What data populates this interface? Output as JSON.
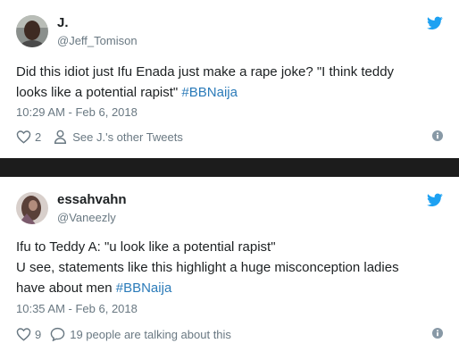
{
  "colors": {
    "link": "#2b7bb9",
    "muted": "#697882",
    "twitter_blue": "#1da1f2"
  },
  "tweets": [
    {
      "name": "J.",
      "handle": "@Jeff_Tomison",
      "body_lines": [
        [
          "Did this idiot just Ifu Enada just make a rape joke? \"I think teddy",
          ""
        ],
        [
          "looks like a potential rapist\" ",
          "#BBNaija"
        ]
      ],
      "timestamp": "10:29 AM - Feb 6, 2018",
      "likes": "2",
      "secondary_action": "See J.'s other Tweets",
      "icons": {
        "like": "heart-icon",
        "secondary": "person-icon",
        "info": "info-icon",
        "brand": "twitter-bird-icon"
      }
    },
    {
      "name": "essahvahn",
      "handle": "@Vaneezly",
      "body_lines": [
        [
          "Ifu to Teddy A: \"u look like a potential rapist\"",
          ""
        ],
        [
          "U see, statements like this highlight a huge misconception ladies",
          ""
        ],
        [
          "have about men ",
          "#BBNaija"
        ]
      ],
      "timestamp": "10:35 AM - Feb 6, 2018",
      "likes": "9",
      "secondary_action": "19 people are talking about this",
      "icons": {
        "like": "heart-icon",
        "secondary": "speech-bubble-icon",
        "info": "info-icon",
        "brand": "twitter-bird-icon"
      }
    }
  ]
}
